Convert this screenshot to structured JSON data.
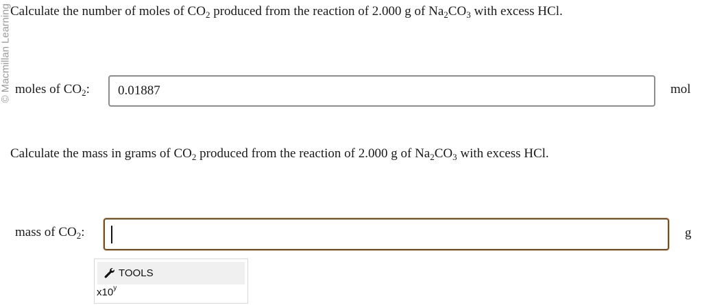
{
  "watermark": "© Macmillan Learning",
  "question1": {
    "text_before": "Calculate the number of moles of CO",
    "co2_sub": "2",
    "text_middle": " produced from the reaction of 2.000 g of Na",
    "na_sub": "2",
    "co": "CO",
    "co3_sub": "3",
    "text_after": " with excess HCl."
  },
  "moles_field": {
    "label_prefix": "moles of CO",
    "label_sub": "2",
    "label_suffix": ":",
    "value": "0.01887",
    "unit": "mol"
  },
  "question2": {
    "text_before": "Calculate the mass in grams of CO",
    "co2_sub": "2",
    "text_middle": " produced from the reaction of 2.000 g of Na",
    "na_sub": "2",
    "co": "CO",
    "co3_sub": "3",
    "text_after": " with excess HCl."
  },
  "mass_field": {
    "label_prefix": "mass of CO",
    "label_sub": "2",
    "label_suffix": ":",
    "value": "",
    "unit": "g"
  },
  "tools": {
    "icon": "wrench-icon",
    "label": "TOOLS",
    "sci_base": "x10",
    "sci_exp": "y"
  }
}
